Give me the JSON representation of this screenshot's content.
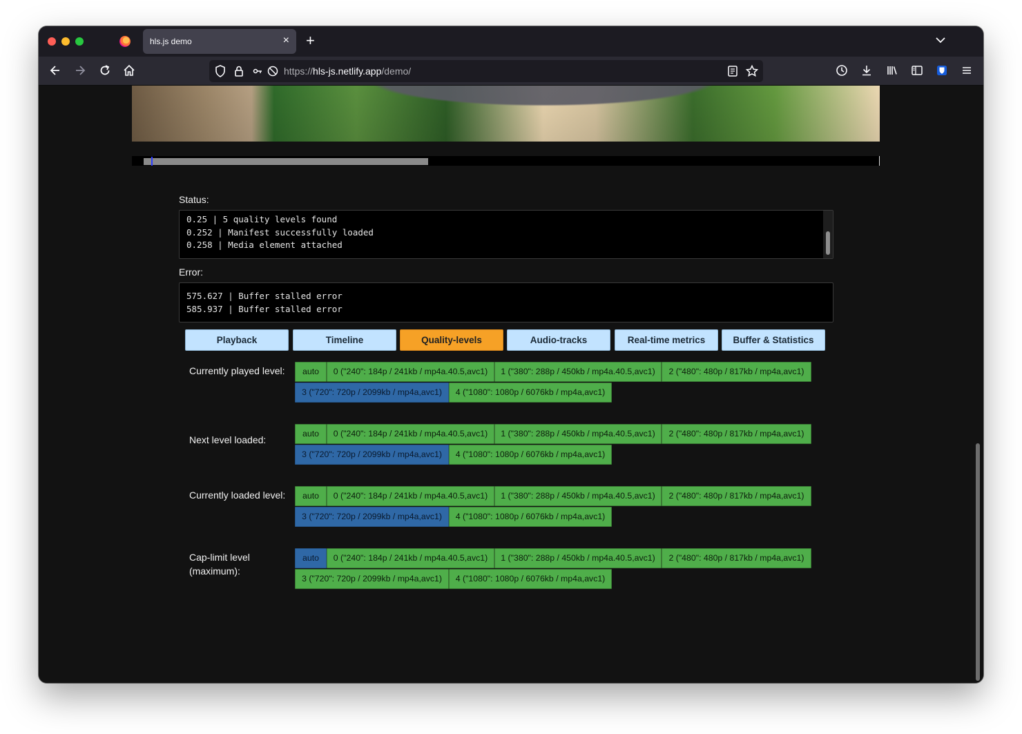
{
  "browser": {
    "tab_title": "hls.js demo",
    "tab_close": "×",
    "new_tab": "+",
    "url_scheme": "https://",
    "url_host": "hls-js.netlify.app",
    "url_path": "/demo/"
  },
  "player": {
    "buffered_fraction": 0.38,
    "playhead_fraction": 0.026
  },
  "status": {
    "label": "Status:",
    "lines": [
      "0.25 | 5 quality levels found",
      "0.252 | Manifest successfully loaded",
      "0.258 | Media element attached"
    ]
  },
  "error": {
    "label": "Error:",
    "lines": [
      "575.627 | Buffer stalled error",
      "585.937 | Buffer stalled error"
    ]
  },
  "tabs": [
    {
      "label": "Playback",
      "active": false
    },
    {
      "label": "Timeline",
      "active": false
    },
    {
      "label": "Quality-levels",
      "active": true
    },
    {
      "label": "Audio-tracks",
      "active": false
    },
    {
      "label": "Real-time metrics",
      "active": false
    },
    {
      "label": "Buffer & Statistics",
      "active": false
    }
  ],
  "levels": [
    "auto",
    "0 (\"240\": 184p / 241kb / mp4a.40.5,avc1)",
    "1 (\"380\": 288p / 450kb / mp4a.40.5,avc1)",
    "2 (\"480\": 480p / 817kb / mp4a,avc1)",
    "3 (\"720\": 720p / 2099kb / mp4a,avc1)",
    "4 (\"1080\": 1080p / 6076kb / mp4a,avc1)"
  ],
  "quality_groups": [
    {
      "label": "Currently played level:",
      "selected_index": 4
    },
    {
      "label": "Next level loaded:",
      "selected_index": 4
    },
    {
      "label": "Currently loaded level:",
      "selected_index": 4
    },
    {
      "label": "Cap-limit level (maximum):",
      "selected_index": 0
    }
  ],
  "colors": {
    "level_default": "#4fae4a",
    "level_selected": "#2f68a6",
    "tab_default": "#c2e3ff",
    "tab_active": "#f6a126"
  }
}
